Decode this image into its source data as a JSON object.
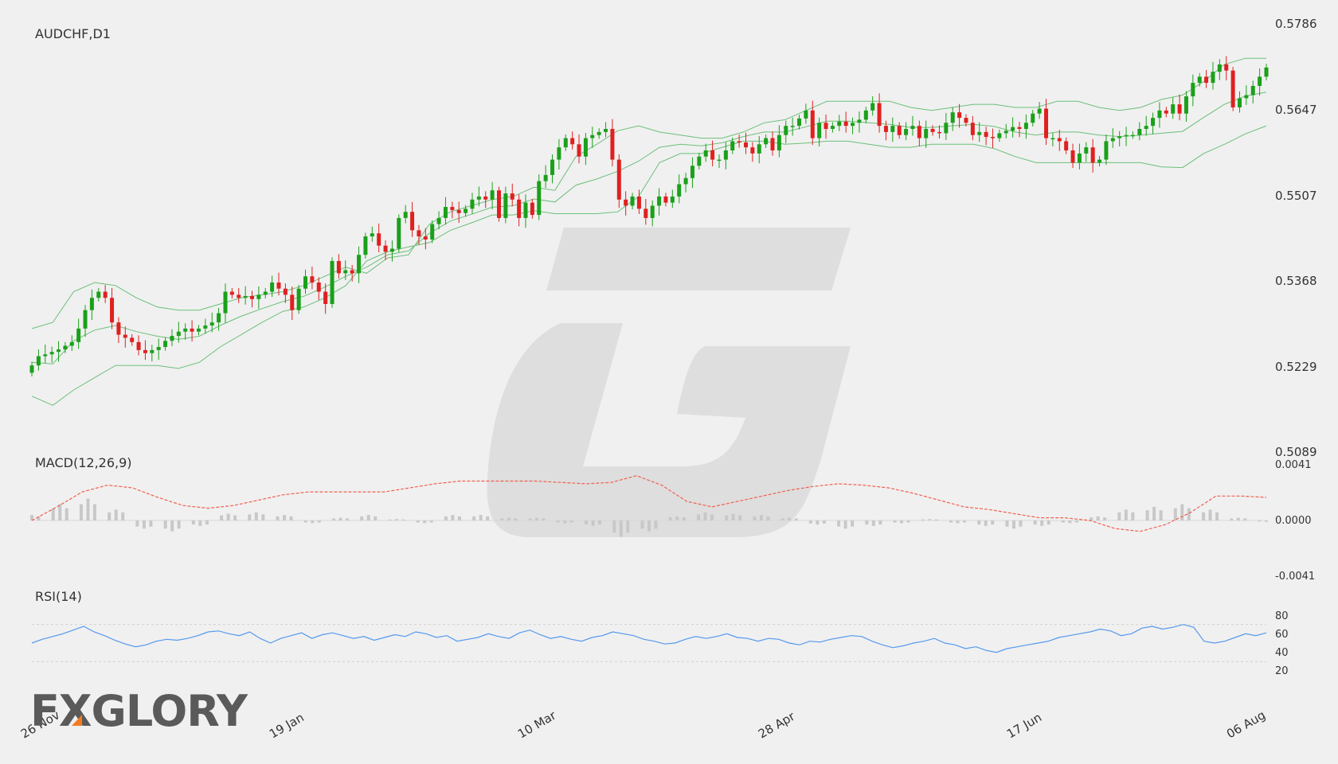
{
  "symbol_label": "AUDCHF,D1",
  "macd_label": "MACD(12,26,9)",
  "rsi_label": "RSI(14)",
  "logo": {
    "text": "FXGLORY",
    "accent": "#f47c20",
    "color": "#5a5a5a"
  },
  "colors": {
    "bull": "#1aa01a",
    "bear": "#e02020",
    "bands": "#6cbf7a",
    "signal": "#f06050",
    "hist": "#c8c8c8",
    "rsi": "#5599ee",
    "watermark": "#dcdcdc"
  },
  "chart_data": [
    {
      "type": "candlestick",
      "title": "AUDCHF,D1",
      "x_tick_labels": [
        "26 Nov",
        "19 Jan",
        "10 Mar",
        "28 Apr",
        "17 Jun",
        "06 Aug"
      ],
      "y_tick_labels": [
        "0.5786",
        "0.5647",
        "0.5507",
        "0.5368",
        "0.5229",
        "0.5089"
      ],
      "ylim": [
        0.5089,
        0.5786
      ],
      "overlay": "bollinger bands",
      "close": [
        0.523,
        0.5245,
        0.5248,
        0.5252,
        0.5256,
        0.5262,
        0.5268,
        0.529,
        0.532,
        0.534,
        0.535,
        0.534,
        0.53,
        0.528,
        0.5275,
        0.5268,
        0.5255,
        0.525,
        0.5255,
        0.526,
        0.527,
        0.5278,
        0.5285,
        0.529,
        0.5285,
        0.529,
        0.5295,
        0.53,
        0.5315,
        0.535,
        0.5345,
        0.534,
        0.5343,
        0.5338,
        0.5345,
        0.535,
        0.5365,
        0.5355,
        0.5345,
        0.532,
        0.5355,
        0.5375,
        0.5365,
        0.535,
        0.533,
        0.54,
        0.538,
        0.5385,
        0.538,
        0.541,
        0.544,
        0.5445,
        0.5425,
        0.5415,
        0.542,
        0.547,
        0.548,
        0.545,
        0.544,
        0.5435,
        0.546,
        0.547,
        0.5488,
        0.5483,
        0.5478,
        0.5485,
        0.55,
        0.5505,
        0.55,
        0.5515,
        0.547,
        0.551,
        0.55,
        0.547,
        0.5495,
        0.5475,
        0.553,
        0.554,
        0.5565,
        0.5585,
        0.56,
        0.559,
        0.557,
        0.56,
        0.5605,
        0.561,
        0.5615,
        0.5565,
        0.55,
        0.549,
        0.5505,
        0.5485,
        0.547,
        0.549,
        0.5505,
        0.5495,
        0.5505,
        0.5525,
        0.5535,
        0.5555,
        0.557,
        0.558,
        0.5565,
        0.5565,
        0.558,
        0.5595,
        0.5593,
        0.5585,
        0.5575,
        0.559,
        0.56,
        0.558,
        0.5605,
        0.562,
        0.562,
        0.5632,
        0.5645,
        0.56,
        0.5625,
        0.5615,
        0.562,
        0.5627,
        0.562,
        0.5625,
        0.563,
        0.5645,
        0.5657,
        0.562,
        0.561,
        0.562,
        0.5605,
        0.5615,
        0.562,
        0.56,
        0.5615,
        0.561,
        0.5608,
        0.5625,
        0.5642,
        0.5633,
        0.5625,
        0.5605,
        0.561,
        0.5602,
        0.56,
        0.5608,
        0.5612,
        0.5618,
        0.5615,
        0.5625,
        0.564,
        0.5648,
        0.56,
        0.56,
        0.5595,
        0.558,
        0.556,
        0.5575,
        0.5585,
        0.556,
        0.5565,
        0.5595,
        0.56,
        0.5603,
        0.5605,
        0.5605,
        0.5615,
        0.562,
        0.5633,
        0.5645,
        0.564,
        0.5655,
        0.564,
        0.5668,
        0.569,
        0.57,
        0.569,
        0.5708,
        0.572,
        0.571,
        0.565,
        0.5665,
        0.567,
        0.5685,
        0.57,
        0.5715
      ],
      "bb_upper": [
        0.529,
        0.53,
        0.535,
        0.5365,
        0.536,
        0.534,
        0.5325,
        0.532,
        0.532,
        0.533,
        0.534,
        0.5345,
        0.535,
        0.536,
        0.5375,
        0.539,
        0.538,
        0.5405,
        0.541,
        0.546,
        0.548,
        0.549,
        0.55,
        0.5505,
        0.552,
        0.5515,
        0.557,
        0.559,
        0.5612,
        0.562,
        0.561,
        0.5605,
        0.56,
        0.56,
        0.561,
        0.5625,
        0.563,
        0.5645,
        0.566,
        0.566,
        0.566,
        0.566,
        0.565,
        0.5645,
        0.565,
        0.5655,
        0.5655,
        0.565,
        0.565,
        0.566,
        0.566,
        0.565,
        0.5645,
        0.565,
        0.5663,
        0.567,
        0.5692,
        0.572,
        0.573,
        0.573
      ],
      "bb_lower": [
        0.518,
        0.5165,
        0.519,
        0.521,
        0.523,
        0.523,
        0.523,
        0.5225,
        0.5235,
        0.526,
        0.528,
        0.53,
        0.5318,
        0.5325,
        0.534,
        0.536,
        0.54,
        0.5415,
        0.5423,
        0.543,
        0.545,
        0.5462,
        0.5475,
        0.5475,
        0.5482,
        0.5477,
        0.5477,
        0.5477,
        0.548,
        0.5505,
        0.556,
        0.5575,
        0.5575,
        0.5585,
        0.5595,
        0.5595,
        0.559,
        0.5592,
        0.5595,
        0.5595,
        0.559,
        0.5585,
        0.5585,
        0.559,
        0.559,
        0.559,
        0.5583,
        0.557,
        0.556,
        0.556,
        0.556,
        0.556,
        0.556,
        0.556,
        0.5553,
        0.5552,
        0.5575,
        0.559,
        0.5607,
        0.562
      ]
    },
    {
      "type": "line+bar",
      "title": "MACD(12,26,9)",
      "y_tick_labels": [
        "0.0041",
        "0.0000",
        "-0.0041"
      ],
      "ylim": [
        -0.0041,
        0.0041
      ],
      "signal": [
        0.0,
        0.001,
        0.0021,
        0.0026,
        0.0024,
        0.0017,
        0.0011,
        0.0009,
        0.0011,
        0.0015,
        0.0019,
        0.0021,
        0.0021,
        0.0021,
        0.0021,
        0.0024,
        0.0027,
        0.0029,
        0.0029,
        0.0029,
        0.0029,
        0.0028,
        0.0027,
        0.0028,
        0.0033,
        0.0026,
        0.0014,
        0.001,
        0.0014,
        0.0018,
        0.0022,
        0.0025,
        0.0027,
        0.0026,
        0.0024,
        0.002,
        0.0015,
        0.001,
        0.0008,
        0.0005,
        0.0002,
        0.0002,
        0.0,
        -0.0006,
        -0.0008,
        -0.0003,
        0.0006,
        0.0018,
        0.0018,
        0.0017
      ],
      "histogram": [
        0.0004,
        0.0012,
        0.0016,
        0.0008,
        -0.0006,
        -0.0008,
        -0.0004,
        0.0005,
        0.0006,
        0.0004,
        -0.0002,
        0.0002,
        0.0004,
        0.0001,
        -0.0002,
        0.0004,
        0.0004,
        0.0002,
        0.0002,
        -0.0002,
        -0.0004,
        -0.0012,
        -0.0008,
        0.0003,
        0.0006,
        0.0005,
        0.0004,
        0.0002,
        -0.0003,
        -0.0006,
        -0.0004,
        -0.0002,
        0.0001,
        -0.0002,
        -0.0004,
        -0.0006,
        -0.0004,
        -0.0002,
        0.0003,
        0.0008,
        0.001,
        0.0012,
        0.0008,
        0.0002,
        -0.0001
      ]
    },
    {
      "type": "line",
      "title": "RSI(14)",
      "y_tick_labels": [
        "80",
        "60",
        "40",
        "20"
      ],
      "ylim": [
        20,
        80
      ],
      "levels": [
        70,
        30
      ],
      "values": [
        50,
        54,
        57,
        60,
        64,
        68,
        62,
        58,
        53,
        49,
        46,
        48,
        52,
        54,
        53,
        55,
        58,
        62,
        63,
        60,
        58,
        62,
        55,
        50,
        55,
        58,
        61,
        55,
        59,
        61,
        58,
        55,
        57,
        53,
        56,
        59,
        57,
        62,
        60,
        56,
        58,
        52,
        54,
        56,
        60,
        57,
        55,
        61,
        64,
        59,
        55,
        57,
        54,
        52,
        56,
        58,
        62,
        60,
        58,
        54,
        52,
        49,
        50,
        54,
        57,
        55,
        57,
        60,
        56,
        55,
        52,
        55,
        54,
        50,
        48,
        52,
        51,
        54,
        56,
        58,
        57,
        52,
        48,
        45,
        47,
        50,
        52,
        55,
        50,
        48,
        44,
        46,
        42,
        40,
        44,
        46,
        48,
        50,
        52,
        56,
        58,
        60,
        62,
        65,
        63,
        58,
        60,
        66,
        68,
        65,
        67,
        70,
        67,
        52,
        50,
        52,
        56,
        60,
        58,
        61
      ]
    }
  ]
}
